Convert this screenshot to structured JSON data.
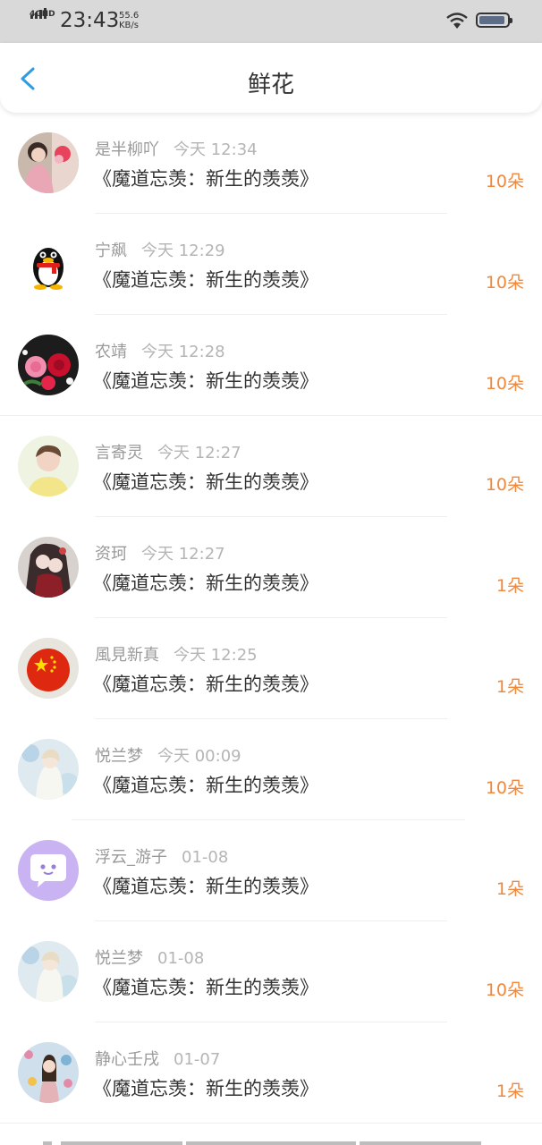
{
  "status_bar": {
    "network": "4GHD",
    "time": "23:43",
    "speed_value": "55.6",
    "speed_unit": "KB/s"
  },
  "header": {
    "title": "鲜花"
  },
  "items": [
    {
      "user": "是半柳吖",
      "time": "今天 12:34",
      "book": "《魔道忘羡：新生的羡羡》",
      "count": "10朵",
      "avatar": "photo-girl-pink"
    },
    {
      "user": "宁飙",
      "time": "今天 12:29",
      "book": "《魔道忘羡：新生的羡羡》",
      "count": "10朵",
      "avatar": "qq-penguin"
    },
    {
      "user": "农靖",
      "time": "今天 12:28",
      "book": "《魔道忘羡：新生的羡羡》",
      "count": "10朵",
      "avatar": "roses"
    },
    {
      "user": "言寄灵",
      "time": "今天 12:27",
      "book": "《魔道忘羡：新生的羡羡》",
      "count": "10朵",
      "avatar": "photo-boy-yellow"
    },
    {
      "user": "资珂",
      "time": "今天 12:27",
      "book": "《魔道忘羡：新生的羡羡》",
      "count": "1朵",
      "avatar": "anime-dark"
    },
    {
      "user": "風見新真",
      "time": "今天 12:25",
      "book": "《魔道忘羡：新生的羡羡》",
      "count": "1朵",
      "avatar": "china-flag"
    },
    {
      "user": "悦兰梦",
      "time": "今天 00:09",
      "book": "《魔道忘羡：新生的羡羡》",
      "count": "10朵",
      "avatar": "anime-light"
    },
    {
      "user": "浮云_游子",
      "time": "01-08",
      "book": "《魔道忘羡：新生的羡羡》",
      "count": "1朵",
      "avatar": "chat-bubble-purple"
    },
    {
      "user": "悦兰梦",
      "time": "01-08",
      "book": "《魔道忘羡：新生的羡羡》",
      "count": "10朵",
      "avatar": "anime-light"
    },
    {
      "user": "静心壬戌",
      "time": "01-07",
      "book": "《魔道忘羡：新生的羡羡》",
      "count": "1朵",
      "avatar": "photo-girl-wall"
    }
  ],
  "colors": {
    "accent": "#2f9be0",
    "count": "#f0883c",
    "status_bar": "#d9d9d9"
  }
}
